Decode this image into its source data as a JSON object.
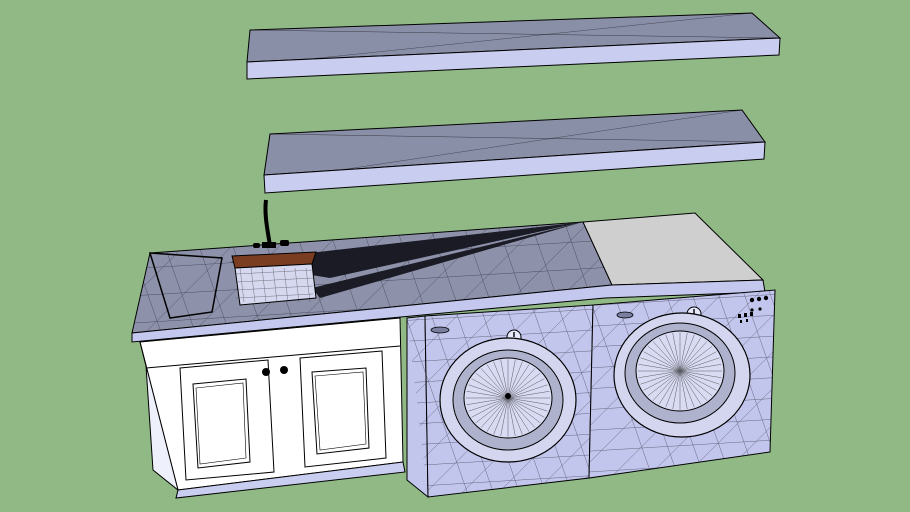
{
  "scene": {
    "colors": {
      "background": "#90b985",
      "shelf_top": "#8a8fa8",
      "shelf_face": "#c9cdf0",
      "counter_top": "#8d92aa",
      "counter_edge": "#c4c8ee",
      "counter_plain": "#cfcfcf",
      "cabinet": "#ffffff",
      "appliance": "#c3c6ec",
      "appliance_dark": "#8e93ad",
      "sink_wood": "#7a3d22",
      "edge": "#000000"
    },
    "icons": [
      "faucet-icon",
      "knob-icon",
      "vent-icon"
    ]
  }
}
